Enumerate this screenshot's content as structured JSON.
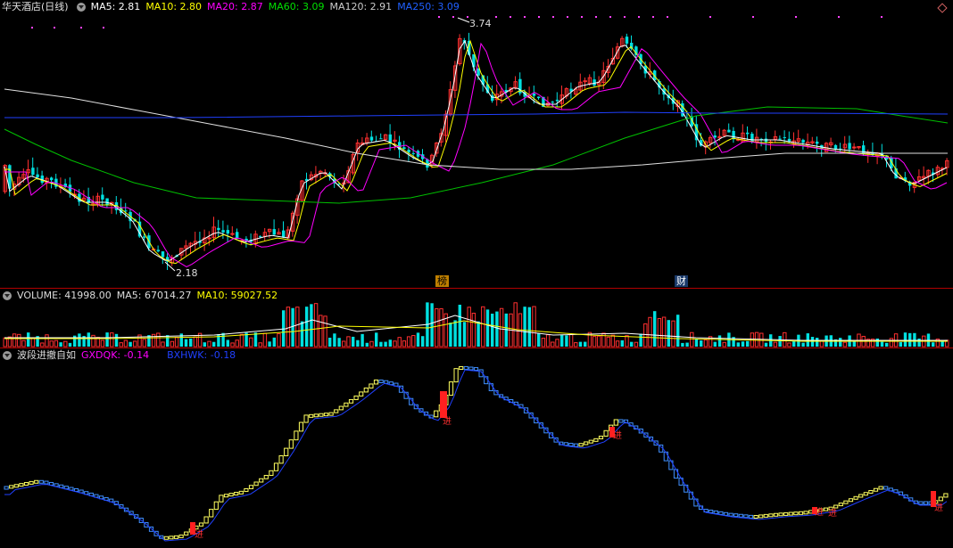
{
  "main": {
    "title": "华天酒店(日线)",
    "indicators": [
      {
        "label": "MA5: 2.81",
        "color": "#ffffff"
      },
      {
        "label": "MA10: 2.80",
        "color": "#ffff00"
      },
      {
        "label": "MA20: 2.87",
        "color": "#ff00ff"
      },
      {
        "label": "MA60: 3.09",
        "color": "#00e000"
      },
      {
        "label": "MA120: 2.91",
        "color": "#cccccc"
      },
      {
        "label": "MA250: 3.09",
        "color": "#2060ff"
      }
    ],
    "high_label": "3.74",
    "low_label": "2.18",
    "marker_bang": "榜",
    "marker_cai": "财"
  },
  "volume": {
    "items": [
      {
        "label": "VOLUME: 41998.00",
        "color": "#dddddd"
      },
      {
        "label": "MA5: 67014.27",
        "color": "#dddddd"
      },
      {
        "label": "MA10: 59027.52",
        "color": "#ffff00"
      }
    ]
  },
  "wave": {
    "title": "波段进撤自如",
    "items": [
      {
        "label": "GXDQK: -0.14",
        "color": "#ff00ff"
      },
      {
        "label": "BXHWK: -0.18",
        "color": "#2040ff"
      }
    ],
    "signal_text": "进"
  },
  "colors": {
    "up": "#ff3030",
    "down": "#00e0e0",
    "separator": "#b00000",
    "bg": "#000000"
  }
}
